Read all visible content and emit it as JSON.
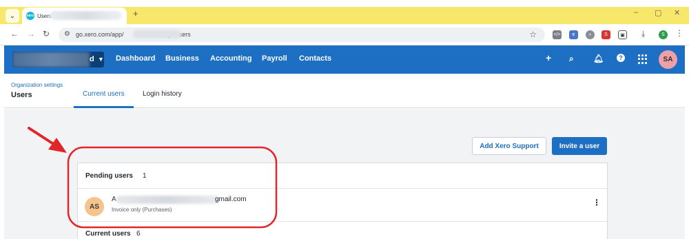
{
  "browser": {
    "tab_title": "Users",
    "tab_favicon": "xero",
    "new_tab": "+",
    "url": "go.xero.com/app/",
    "url_tail": "ettings/users",
    "window_controls": [
      "–",
      "▢",
      "✕"
    ]
  },
  "xero": {
    "org_letter": "d",
    "nav": [
      "Dashboard",
      "Business",
      "Accounting",
      "Payroll",
      "Contacts"
    ],
    "avatar_initials": "SA"
  },
  "subheader": {
    "breadcrumb": "Organization settings",
    "title": "Users",
    "tabs": [
      "Current users",
      "Login history"
    ]
  },
  "actions": {
    "add_support": "Add Xero Support",
    "invite": "Invite a user"
  },
  "pending": {
    "title": "Pending users",
    "count": "1",
    "user": {
      "initials": "AS",
      "email_prefix": "A",
      "email_tail": "gmail.com",
      "role": "Invoice only (Purchases)"
    }
  },
  "current": {
    "title": "Current users",
    "count": "6"
  },
  "annotation_color": "#e0262b",
  "accent": "#1c6fc2"
}
